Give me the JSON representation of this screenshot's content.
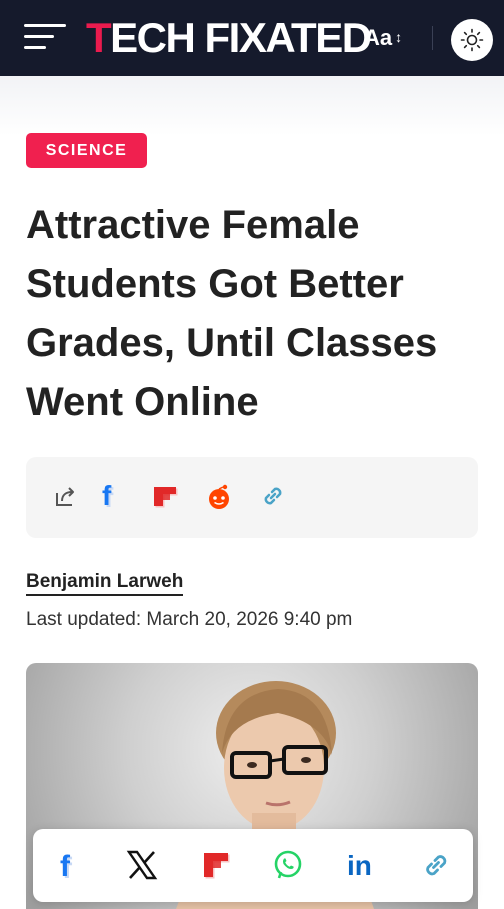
{
  "header": {
    "logo_first": "T",
    "logo_rest": "ECH FIXATED",
    "font_size_label": "Aa",
    "font_size_arrow": "↕"
  },
  "article": {
    "category": "SCIENCE",
    "title": "Attractive Female Students Got Better Grades, Until Classes Went Online",
    "author": "Benjamin Larweh",
    "last_updated": "Last updated: March 20, 2026 9:40 pm"
  },
  "share_icons": [
    "share-icon",
    "facebook-icon",
    "flipboard-icon",
    "reddit-icon",
    "copy-link-icon"
  ],
  "sticky_share_icons": [
    "facebook-icon",
    "x-icon",
    "flipboard-icon",
    "whatsapp-icon",
    "linkedin-icon",
    "copy-link-icon"
  ],
  "colors": {
    "header_bg": "#151a2c",
    "accent": "#ea1b4e",
    "category_bg": "#f0204f",
    "facebook": "#1877f2",
    "flipboard": "#e12828",
    "reddit": "#ff4500",
    "whatsapp": "#25d366",
    "linkedin": "#0a66c2",
    "link": "#4aa3c7"
  }
}
